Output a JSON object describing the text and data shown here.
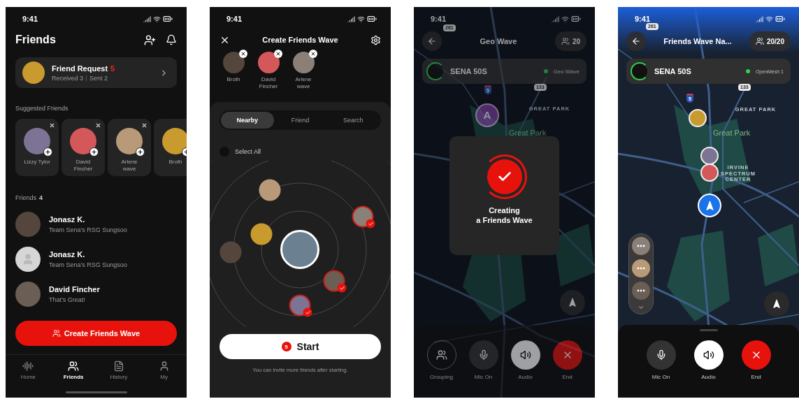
{
  "friends_screen": {
    "status_time": "9:41",
    "title": "Friends",
    "friend_request": {
      "title": "Friend Request",
      "count": "5",
      "received": "Received 3",
      "sent": "Sent 2"
    },
    "suggested_heading": "Suggested Friends",
    "suggested": [
      {
        "name": "Lizzy Tylor"
      },
      {
        "name": "David Fincher"
      },
      {
        "name": "Arlene wave"
      },
      {
        "name": "Broth"
      }
    ],
    "friends_heading": "Friends",
    "friends_count": "4",
    "friends": [
      {
        "name": "Jonasz K.",
        "status": "Team Sena's RSG Sungsoo",
        "kind": "photo"
      },
      {
        "name": "Jonasz K.",
        "status": "Team Sena's RSG Sungsoo",
        "kind": "placeholder"
      },
      {
        "name": "David Fincher",
        "status": "That’s Great!",
        "kind": "photo"
      }
    ],
    "create_button": "Create Friends Wave",
    "nav": [
      {
        "label": "Home",
        "selected": false
      },
      {
        "label": "Friends",
        "selected": true
      },
      {
        "label": "History",
        "selected": false
      },
      {
        "label": "My",
        "selected": false
      }
    ]
  },
  "create_wave_screen": {
    "status_time": "9:41",
    "title": "Create Friends Wave",
    "selected_friends": [
      {
        "name": "Broth"
      },
      {
        "name": "David Fincher"
      },
      {
        "name": "Arlene wave"
      }
    ],
    "tabs": [
      {
        "label": "Nearby",
        "selected": true
      },
      {
        "label": "Friend",
        "selected": false
      },
      {
        "label": "Search",
        "selected": false
      }
    ],
    "select_all": {
      "label": "Select All",
      "checked": false
    },
    "nearby": [
      {
        "checked": false
      },
      {
        "checked": false
      },
      {
        "checked": false
      },
      {
        "checked": true
      },
      {
        "checked": true
      },
      {
        "checked": true
      }
    ],
    "start_button": {
      "count": "5",
      "label": "Start"
    },
    "hint": "You can invite more friends after starting."
  },
  "geo_wave_screen": {
    "status_time": "9:41",
    "title": "Geo Wave",
    "member_count": "20",
    "device": {
      "name": "SENA 50S",
      "mode": "Geo Wave"
    },
    "map_labels": [
      {
        "text": "261",
        "kind": "shield"
      },
      {
        "text": "5",
        "kind": "interstate"
      },
      {
        "text": "133",
        "kind": "shield"
      },
      {
        "text": "GREAT PARK",
        "kind": "area"
      },
      {
        "text": "Great Park",
        "kind": "park"
      },
      {
        "text": "A",
        "kind": "marker"
      }
    ],
    "dialog": "Creating\na Friends Wave",
    "controls": [
      {
        "kind": "grouping",
        "label": "Grouping"
      },
      {
        "kind": "mic",
        "label": "Mic On"
      },
      {
        "kind": "audio",
        "label": "Audio"
      },
      {
        "kind": "end",
        "label": "End"
      }
    ]
  },
  "map_screen": {
    "status_time": "9:41",
    "title": "Friends Wave Na...",
    "member_count": "20/20",
    "device": {
      "name": "SENA 50S",
      "mode": "OpenMesh 1"
    },
    "map_labels": [
      {
        "text": "261",
        "kind": "shield"
      },
      {
        "text": "5",
        "kind": "interstate"
      },
      {
        "text": "133",
        "kind": "shield"
      },
      {
        "text": "GREAT PARK",
        "kind": "area"
      },
      {
        "text": "Great Park",
        "kind": "park"
      },
      {
        "text": "IRVINE SPECTRUM CENTER",
        "kind": "area"
      }
    ],
    "controls": [
      {
        "kind": "mic",
        "label": "Mic On"
      },
      {
        "kind": "audio",
        "label": "Audio"
      },
      {
        "kind": "end",
        "label": "End"
      }
    ]
  }
}
